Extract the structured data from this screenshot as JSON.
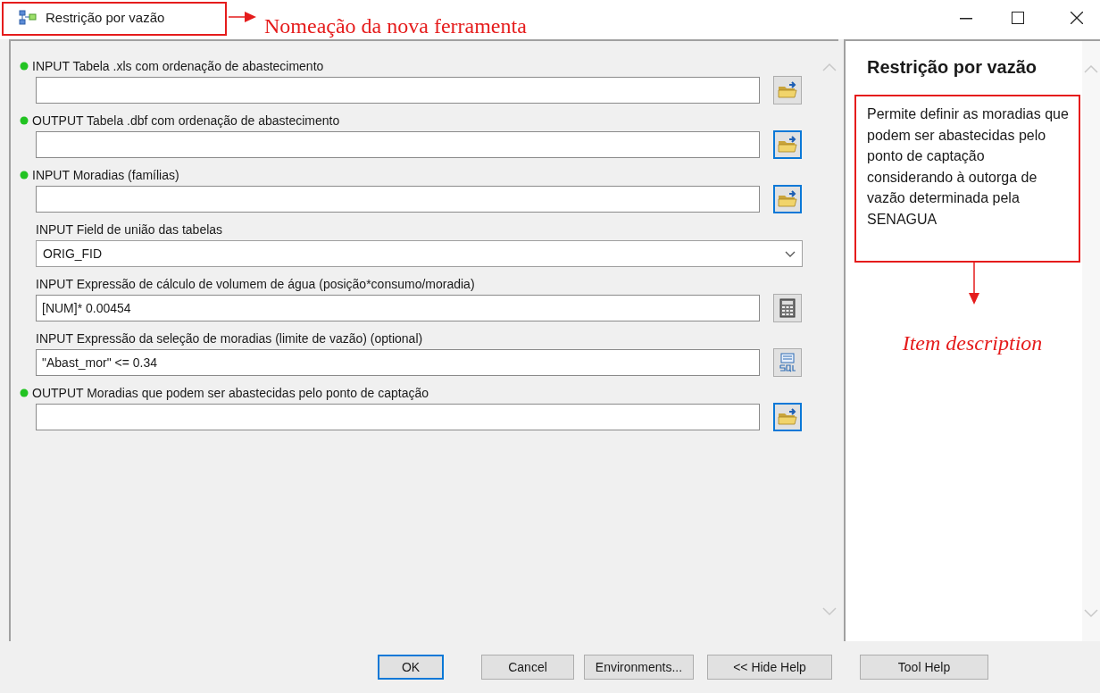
{
  "window": {
    "title": "Restrição por vazão"
  },
  "title_annotation": "Nomeação da nova ferramenta",
  "parameters": [
    {
      "kind": "field",
      "label": "INPUT Tabela .xls com ordenação de abastecimento",
      "required": true,
      "button": {
        "kind": "folder",
        "highlighted": false
      }
    },
    {
      "kind": "field",
      "label": "OUTPUT Tabela .dbf com ordenação de abastecimento",
      "required": true,
      "button": {
        "kind": "folder",
        "highlighted": true
      }
    },
    {
      "kind": "field",
      "label": "INPUT Moradias (famílias)",
      "required": true,
      "button": {
        "kind": "folder",
        "highlighted": true
      }
    },
    {
      "kind": "dropdown",
      "label": "INPUT Field de união das tabelas",
      "required": false,
      "value": "ORIG_FID"
    },
    {
      "kind": "field",
      "label": "INPUT Expressão de cálculo de volumem de água (posição*consumo/moradia)",
      "required": false,
      "value": "[NUM]* 0.00454",
      "button": {
        "kind": "calculator",
        "highlighted": false
      }
    },
    {
      "kind": "field",
      "label": "INPUT Expressão da seleção de moradias (limite de vazão) (optional)",
      "required": false,
      "value": "\"Abast_mor\" <= 0.34",
      "button": {
        "kind": "sql",
        "highlighted": false
      }
    },
    {
      "kind": "field",
      "label": "OUTPUT Moradias que podem ser abastecidas pelo ponto de captação",
      "required": true,
      "button": {
        "kind": "folder",
        "highlighted": true
      }
    }
  ],
  "help": {
    "title": "Restrição por vazão",
    "description": "Permite definir as moradias que podem ser abastecidas pelo ponto de captação considerando à outorga de vazão determinada pela SENAGUA",
    "annotation": "Item description"
  },
  "buttons": [
    {
      "label": "OK",
      "selected": true
    },
    {
      "label": "Cancel",
      "selected": false
    },
    {
      "label": "Environments...",
      "selected": false
    },
    {
      "label": "<< Hide Help",
      "selected": false
    },
    {
      "label": "Tool Help",
      "selected": false
    }
  ]
}
